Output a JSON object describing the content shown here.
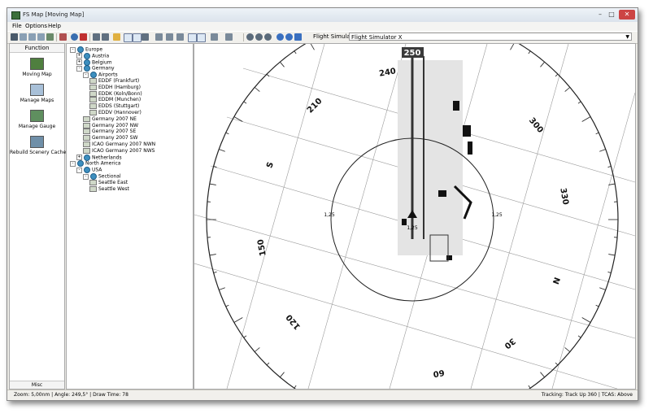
{
  "window": {
    "title": "FS Map [Moving Map]"
  },
  "menu": [
    "File",
    "Options",
    "Help"
  ],
  "toolbar": {
    "simulator_label": "Flight Simulator",
    "simulator_value": "Flight Simulator X"
  },
  "function_panel": {
    "header": "Function",
    "items": [
      {
        "label": "Moving Map",
        "icon": "moving-map-icon"
      },
      {
        "label": "Manage Maps",
        "icon": "manage-maps-icon"
      },
      {
        "label": "Manage Gauge",
        "icon": "manage-gauge-icon"
      },
      {
        "label": "Rebuild Scenery Cache",
        "icon": "rebuild-cache-icon"
      }
    ],
    "misc_tab": "Misc"
  },
  "tree": [
    {
      "label": "Europe",
      "level": 0,
      "type": "globe",
      "expander": "-"
    },
    {
      "label": "Austria",
      "level": 1,
      "type": "globe",
      "expander": "+"
    },
    {
      "label": "Belgium",
      "level": 1,
      "type": "globe",
      "expander": "+"
    },
    {
      "label": "Germany",
      "level": 1,
      "type": "globe",
      "expander": "-"
    },
    {
      "label": "Airports",
      "level": 2,
      "type": "globe",
      "expander": "-"
    },
    {
      "label": "EDDF (Frankfurt)",
      "level": 3,
      "type": "map",
      "expander": ""
    },
    {
      "label": "EDDH (Hamburg)",
      "level": 3,
      "type": "map",
      "expander": ""
    },
    {
      "label": "EDDK (Koln/Bonn)",
      "level": 3,
      "type": "map",
      "expander": ""
    },
    {
      "label": "EDDM (Munchen)",
      "level": 3,
      "type": "map",
      "expander": ""
    },
    {
      "label": "EDDS (Stuttgart)",
      "level": 3,
      "type": "map",
      "expander": ""
    },
    {
      "label": "EDDV (Hannover)",
      "level": 3,
      "type": "map",
      "expander": ""
    },
    {
      "label": "Germany 2007 NE",
      "level": 2,
      "type": "map",
      "expander": ""
    },
    {
      "label": "Germany 2007 NW",
      "level": 2,
      "type": "map",
      "expander": ""
    },
    {
      "label": "Germany 2007 SE",
      "level": 2,
      "type": "map",
      "expander": ""
    },
    {
      "label": "Germany 2007 SW",
      "level": 2,
      "type": "map",
      "expander": ""
    },
    {
      "label": "ICAO Germany 2007 NWN",
      "level": 2,
      "type": "map",
      "expander": ""
    },
    {
      "label": "ICAO Germany 2007 NWS",
      "level": 2,
      "type": "map",
      "expander": ""
    },
    {
      "label": "Netherlands",
      "level": 1,
      "type": "globe",
      "expander": "+"
    },
    {
      "label": "North America",
      "level": 0,
      "type": "globe",
      "expander": "-"
    },
    {
      "label": "USA",
      "level": 1,
      "type": "globe",
      "expander": "-"
    },
    {
      "label": "Sectional",
      "level": 2,
      "type": "globe",
      "expander": "-"
    },
    {
      "label": "Seattle East",
      "level": 3,
      "type": "map",
      "expander": ""
    },
    {
      "label": "Seattle West",
      "level": 3,
      "type": "map",
      "expander": ""
    }
  ],
  "map": {
    "heading": "250",
    "range_labels": [
      "1,25",
      "1,25",
      "1,25"
    ],
    "compass_labels": [
      "210",
      "240",
      "300",
      "330",
      "N",
      "30",
      "60",
      "120",
      "150",
      "S"
    ]
  },
  "status": {
    "left": "Zoom: 5,00nm | Angle: 249,5° | Draw Time: 78",
    "right": "Tracking: Track Up 360 | TCAS: Above"
  }
}
